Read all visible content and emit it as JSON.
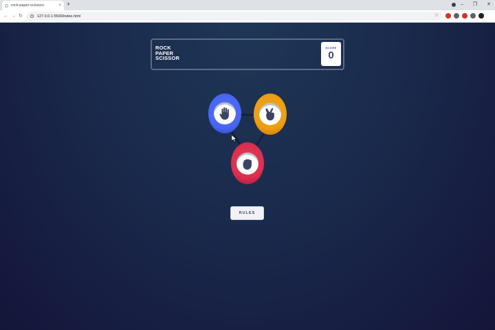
{
  "browser": {
    "tab_title": "rock-paper-scissors",
    "tab_close": "×",
    "new_tab": "+",
    "url": "127.0.0.1:5500/index.html",
    "nav": {
      "back": "←",
      "forward": "→",
      "reload": "↻"
    },
    "star": "☆",
    "window_controls": {
      "minimize": "–",
      "restore": "❐",
      "close": "✕"
    },
    "extension_colors": [
      "#d93025",
      "#5f6368",
      "#d93025",
      "#5f6368",
      "#202124"
    ]
  },
  "game": {
    "title_lines": [
      "ROCK",
      "PAPER",
      "SCISSOR"
    ],
    "score_label": "SCORE",
    "score_value": "0",
    "choices": [
      {
        "name": "paper",
        "icon": "hand-paper-icon",
        "color": "#4865f4"
      },
      {
        "name": "scissors",
        "icon": "hand-scissors-icon",
        "color": "#ec9e0e"
      },
      {
        "name": "rock",
        "icon": "hand-rock-icon",
        "color": "#dc2e4e"
      }
    ],
    "rules_label": "RULES"
  },
  "colors": {
    "background": "#1f3756",
    "background_dark": "#141539",
    "header_outline": "#5e6b84",
    "score_text": "#3b4363"
  }
}
